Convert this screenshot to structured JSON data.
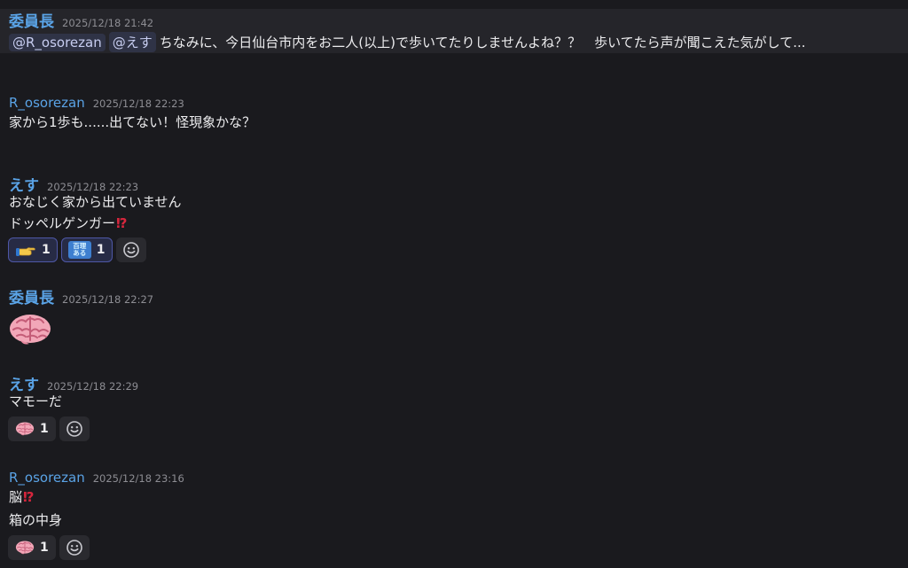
{
  "messages": [
    {
      "author": "委員長",
      "timestamp": "2025/12/18 21:42",
      "mentions": [
        "@R_osorezan",
        "@えす"
      ],
      "text": "ちなみに、今日仙台市内をお二人(以上)で歩いてたりしませんよね？？　歩いてたら声が聞こえた気がして..."
    },
    {
      "author": "R_osorezan",
      "timestamp": "2025/12/18 22:23",
      "lines": [
        "家から1歩も......出てない！怪現象かな？"
      ]
    },
    {
      "author": "えす",
      "timestamp": "2025/12/18 22:23",
      "lines": [
        "おなじく家から出ていません",
        "ドッペルゲンガー"
      ],
      "reactions": [
        {
          "icon": "pointing-hand-icon",
          "count": "1"
        },
        {
          "icon": "hyakuri-aru-stamp-icon",
          "stamp_top": "百理",
          "stamp_bottom": "ある",
          "count": "1"
        }
      ]
    },
    {
      "author": "委員長",
      "timestamp": "2025/12/18 22:27",
      "emoji": "brain-icon"
    },
    {
      "author": "えす",
      "timestamp": "2025/12/18 22:29",
      "lines": [
        "マモーだ"
      ],
      "reactions": [
        {
          "icon": "brain-icon",
          "count": "1"
        }
      ]
    },
    {
      "author": "R_osorezan",
      "timestamp": "2025/12/18 23:16",
      "lines": [
        "脳",
        "箱の中身"
      ],
      "reactions": [
        {
          "icon": "brain-icon",
          "count": "1"
        }
      ]
    }
  ],
  "colors": {
    "background": "#1a1a1e",
    "highlight_background": "#25252a",
    "author": "#5aa3e6",
    "timestamp": "#8d8d93",
    "mention_background": "#2f3346",
    "active_reaction_border": "#4e57a6",
    "interrobang": "#d7263d"
  }
}
